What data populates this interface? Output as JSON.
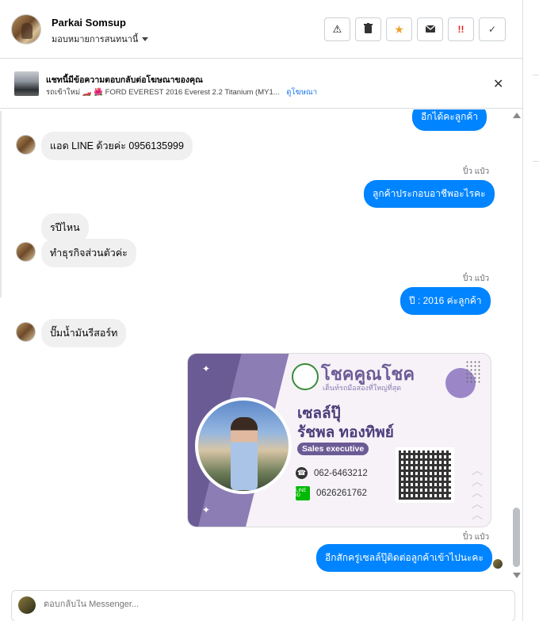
{
  "header": {
    "contact_name": "Parkai Somsup",
    "assign_label": "มอบหมายการสนทนานี้",
    "actions": [
      {
        "icon": "warning-icon",
        "glyph": "⚠"
      },
      {
        "icon": "trash-icon",
        "glyph": "🗑"
      },
      {
        "icon": "star-icon",
        "glyph": "★"
      },
      {
        "icon": "mail-icon",
        "glyph": "✉"
      },
      {
        "icon": "urgent-icon",
        "glyph": "!!"
      },
      {
        "icon": "check-icon",
        "glyph": "✓"
      }
    ]
  },
  "banner": {
    "title": "แชทนี้มีข้อความตอบกลับต่อโฆษณาของคุณ",
    "subtitle": "รถเข้าใหม่ 🏎️ 🌺  FORD EVEREST 2016 Everest 2.2 Titanium (MY1...",
    "link": "ดูโฆษณา",
    "close_glyph": "✕"
  },
  "messages": {
    "top_partial": "อีกได้คะลูกค้า",
    "in_1": "แอด LINE ด้วยค่ะ 0956135999",
    "sender_1": "ปิ๋ว แป๋ว",
    "out_1": "ลูกค้าประกอบอาชีพอะไรคะ",
    "in_2a": "รปีไหน",
    "in_2b": "ทำธุรกิจส่วนตัวค่ะ",
    "sender_2": "ปิ๋ว แป๋ว",
    "out_2": "ปี : 2016  ค่ะลูกค้า",
    "in_3": "ปั๊มน้ำมันรีสอร์ท",
    "sender_3": "ปิ๋ว แป๋ว",
    "out_3": "อีกสักครู่เซลล์ปุ๊ติดต่อลูกค้าเข้าไปนะคะ"
  },
  "card": {
    "brand": "โชคคูณโชค",
    "brand_sub": "เต็นท์รถมือสองที่ใหญ่ที่สุด",
    "nickname": "เซลล์ปุ๊",
    "fullname": "รัชพล  ทองทิพย์",
    "role": "Sales executive",
    "phone": "062-6463212",
    "line_id": "0626261762",
    "line_icon_label": "LINE ID"
  },
  "reply": {
    "placeholder": "ตอบกลับใน Messenger..."
  }
}
